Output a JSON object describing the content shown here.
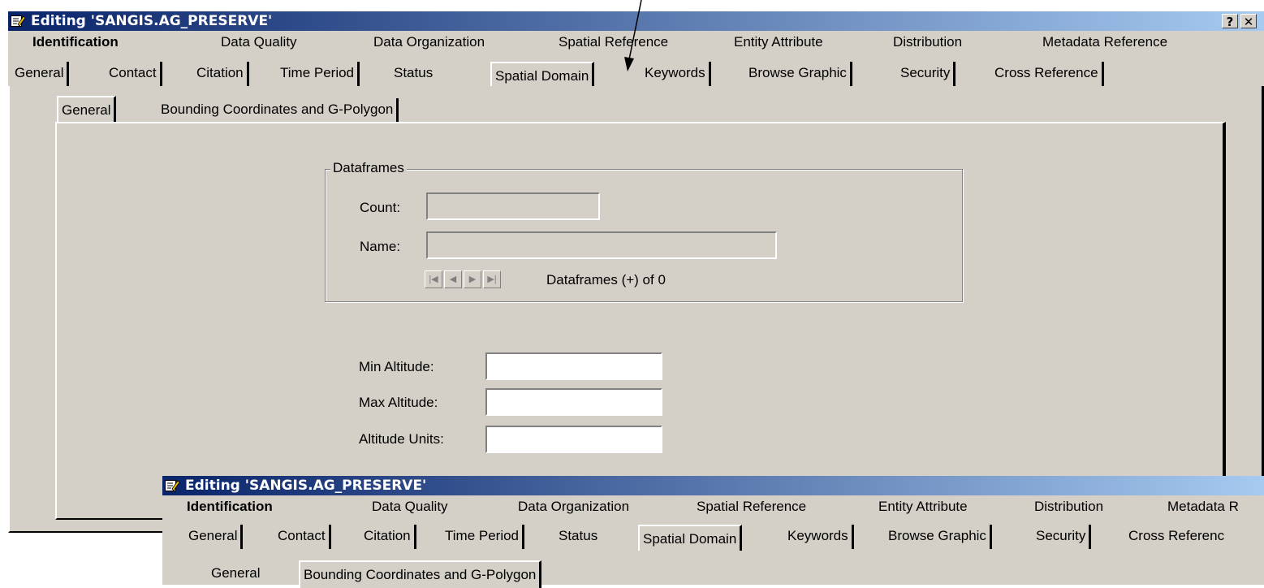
{
  "window": {
    "title": "Editing 'SANGIS.AG_PRESERVE'",
    "help_label": "?",
    "close_label": "✕"
  },
  "menu": [
    {
      "label": "Identification",
      "active": true
    },
    {
      "label": "Data Quality"
    },
    {
      "label": "Data Organization"
    },
    {
      "label": "Spatial Reference"
    },
    {
      "label": "Entity Attribute"
    },
    {
      "label": "Distribution"
    },
    {
      "label": "Metadata Reference"
    }
  ],
  "tabs": [
    {
      "label": "General"
    },
    {
      "label": "Contact"
    },
    {
      "label": "Citation"
    },
    {
      "label": "Time Period"
    },
    {
      "label": "Status"
    },
    {
      "label": "Spatial Domain",
      "selected": true
    },
    {
      "label": "Keywords"
    },
    {
      "label": "Browse Graphic"
    },
    {
      "label": "Security"
    },
    {
      "label": "Cross Reference"
    }
  ],
  "subtabs": [
    {
      "label": "General",
      "selected": true
    },
    {
      "label": "Bounding Coordinates and G-Polygon"
    }
  ],
  "dataframes": {
    "legend": "Dataframes",
    "count_label": "Count:",
    "count_value": "",
    "name_label": "Name:",
    "name_value": "",
    "nav_status": "Dataframes (+) of 0"
  },
  "altitude": {
    "min_label": "Min Altitude:",
    "min_value": "",
    "max_label": "Max Altitude:",
    "max_value": "",
    "units_label": "Altitude Units:",
    "units_value": ""
  },
  "second_window": {
    "title": "Editing 'SANGIS.AG_PRESERVE'",
    "menu": [
      {
        "label": "Identification",
        "active": true
      },
      {
        "label": "Data Quality"
      },
      {
        "label": "Data Organization"
      },
      {
        "label": "Spatial Reference"
      },
      {
        "label": "Entity Attribute"
      },
      {
        "label": "Distribution"
      },
      {
        "label": "Metadata R"
      }
    ],
    "tabs": [
      {
        "label": "General"
      },
      {
        "label": "Contact"
      },
      {
        "label": "Citation"
      },
      {
        "label": "Time Period"
      },
      {
        "label": "Status"
      },
      {
        "label": "Spatial Domain",
        "selected": true
      },
      {
        "label": "Keywords"
      },
      {
        "label": "Browse Graphic"
      },
      {
        "label": "Security"
      },
      {
        "label": "Cross Referenc"
      }
    ],
    "subtabs": [
      {
        "label": "General",
        "selected": true
      },
      {
        "label": "Bounding Coordinates and G-Polygon"
      }
    ]
  },
  "icons": {
    "title_icon": "edit-icon",
    "annotation": "pointer-arrow"
  }
}
